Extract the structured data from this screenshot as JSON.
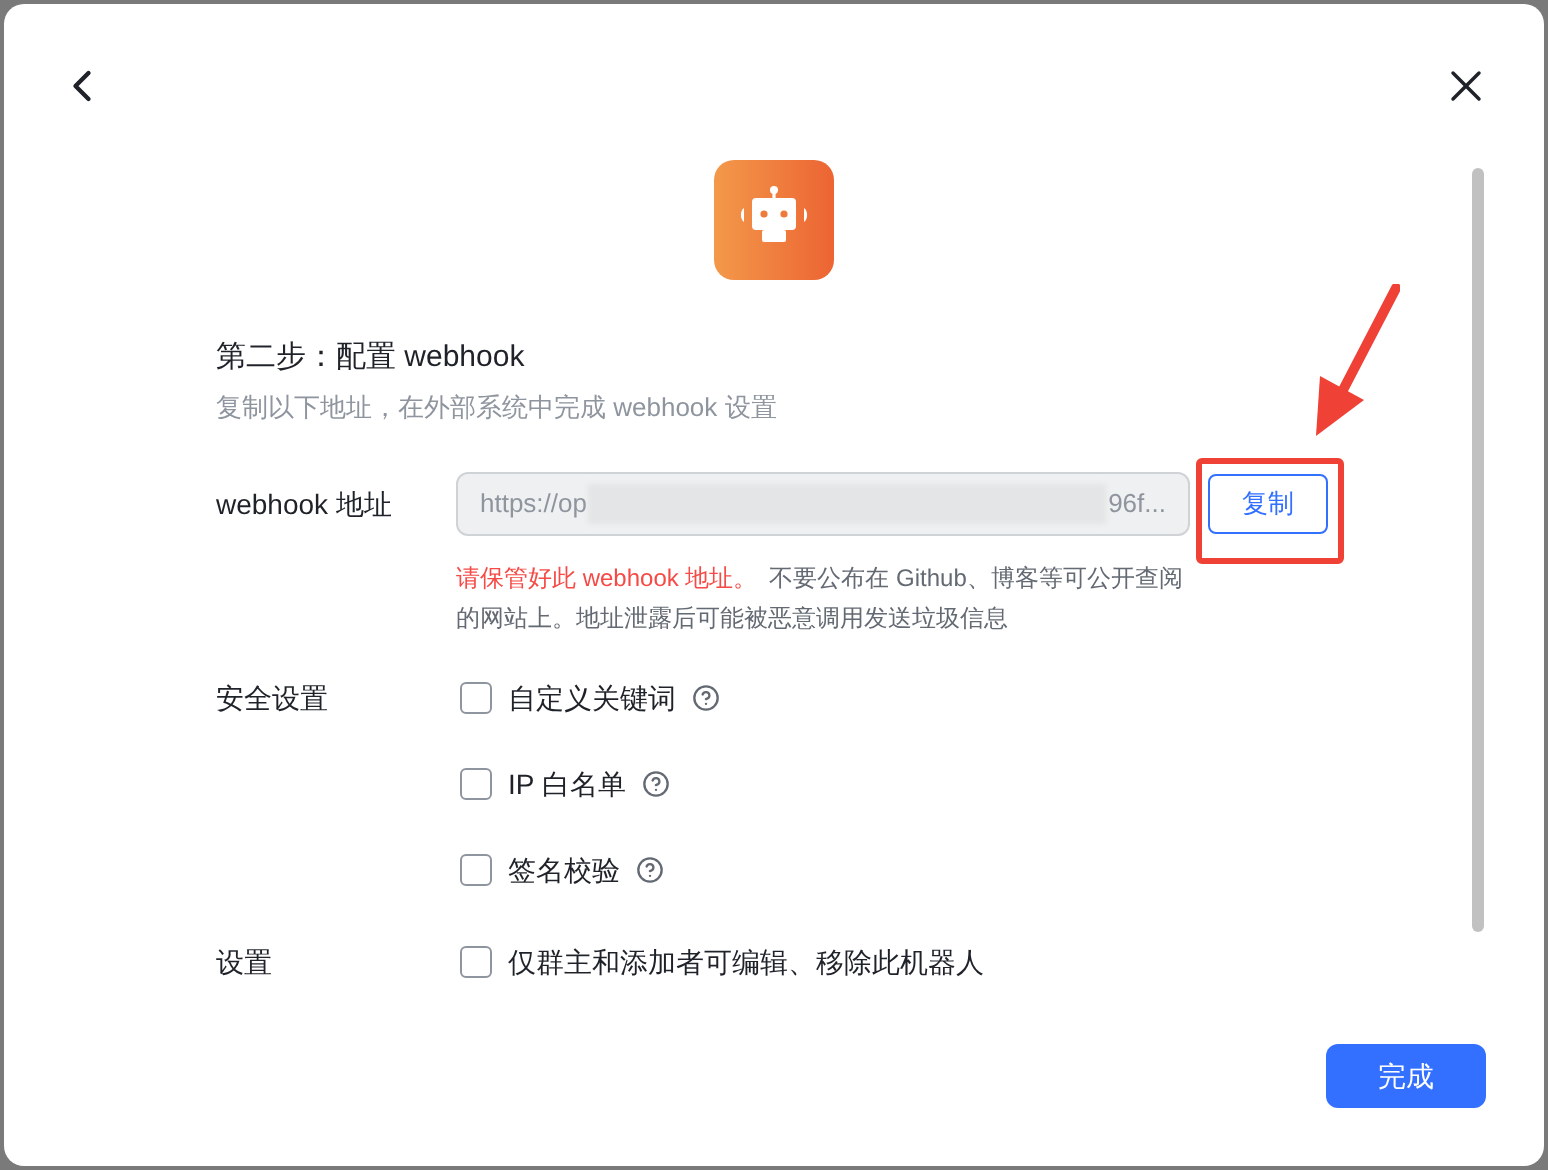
{
  "dialog": {
    "step_title": "第二步：配置 webhook",
    "subtitle": "复制以下地址，在外部系统中完成 webhook 设置",
    "webhook": {
      "label": "webhook 地址",
      "value_start": "https://op",
      "value_end": "96f...",
      "copy_button": "复制"
    },
    "warning": {
      "emphasis": "请保管好此 webhook 地址。",
      "rest": "不要公布在 Github、博客等可公开查阅",
      "rest_continued": "的网站上。地址泄露后可能被恶意调用发送垃圾信息"
    },
    "security": {
      "label": "安全设置",
      "options": [
        {
          "label": "自定义关键词",
          "checked": false
        },
        {
          "label": "IP 白名单",
          "checked": false
        },
        {
          "label": "签名校验",
          "checked": false
        }
      ]
    },
    "settings": {
      "label": "设置",
      "options": [
        {
          "label": "仅群主和添加者可编辑、移除此机器人",
          "checked": false
        }
      ]
    },
    "done_button": "完成"
  }
}
